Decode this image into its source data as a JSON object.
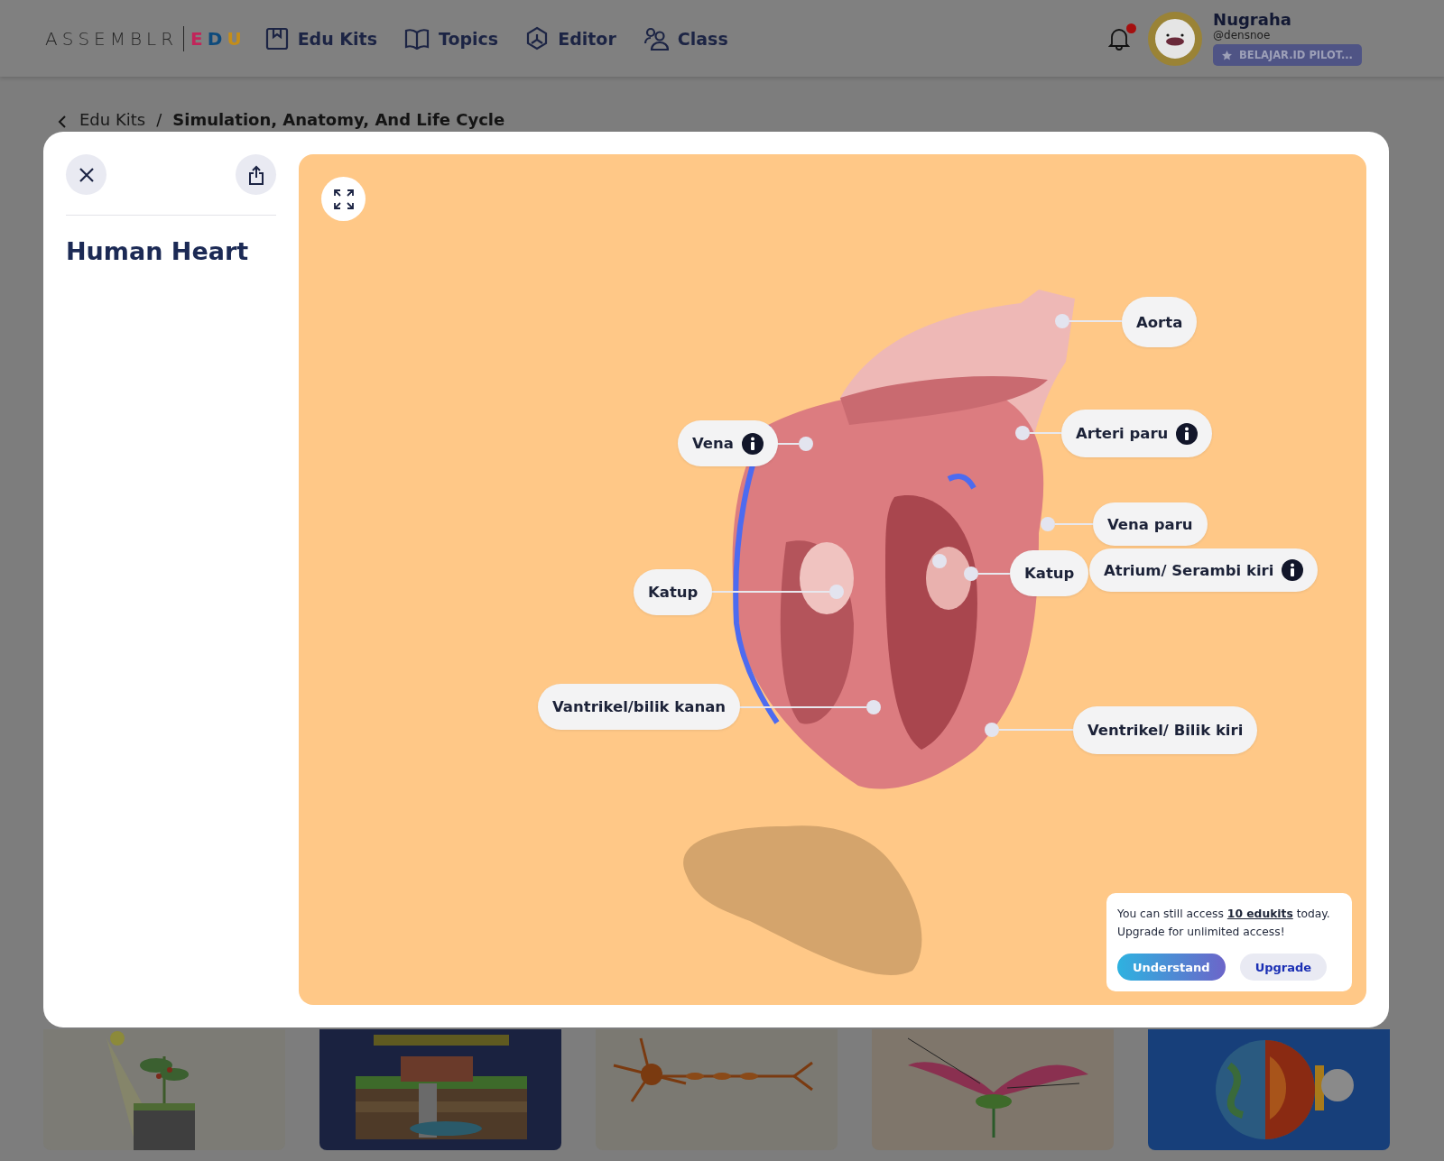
{
  "header": {
    "logo": {
      "brand": "ASSEMBLR",
      "suffix": [
        {
          "text": "E",
          "color": "#c2255a"
        },
        {
          "text": "D",
          "color": "#0d4a7c"
        },
        {
          "text": "U",
          "color": "#c38d1a"
        }
      ]
    },
    "nav": [
      {
        "kind": "kits",
        "label": "Edu Kits"
      },
      {
        "kind": "topics",
        "label": "Topics"
      },
      {
        "kind": "editor",
        "label": "Editor"
      },
      {
        "kind": "class",
        "label": "Class"
      }
    ],
    "notifications": {
      "unread": true
    },
    "user": {
      "name": "Nugraha",
      "handle": "@densnoe",
      "badge": "BELAJAR.ID PILOT..."
    }
  },
  "breadcrumb": {
    "items": [
      "Edu Kits",
      "Simulation, Anatomy, And Life Cycle"
    ],
    "separator": "/"
  },
  "modal": {
    "title": "Human Heart",
    "viewer": {
      "labels": [
        {
          "text": "Aorta",
          "info": false
        },
        {
          "text": "Arteri paru",
          "info": true
        },
        {
          "text": "Vena",
          "info": true
        },
        {
          "text": "Vena paru",
          "info": false
        },
        {
          "text": "Katup",
          "info": false
        },
        {
          "text": "Atrium/ Serambi kiri",
          "info": true
        },
        {
          "text": "Katup",
          "info": false
        },
        {
          "text": "Vantrikel/bilik kanan",
          "info": false
        },
        {
          "text": "Ventrikel/ Bilik kiri",
          "info": false
        }
      ],
      "notice": {
        "message": "You can still access **10 edukits** today. Upgrade for unlimited access!",
        "buttons": [
          {
            "kind": "primary",
            "label": "Understand"
          },
          {
            "kind": "secondary",
            "label": "Upgrade"
          }
        ]
      }
    }
  },
  "thumbnails": [
    {
      "kind": "plant"
    },
    {
      "kind": "soil"
    },
    {
      "kind": "neuron"
    },
    {
      "kind": "flower"
    },
    {
      "kind": "earth"
    }
  ]
}
